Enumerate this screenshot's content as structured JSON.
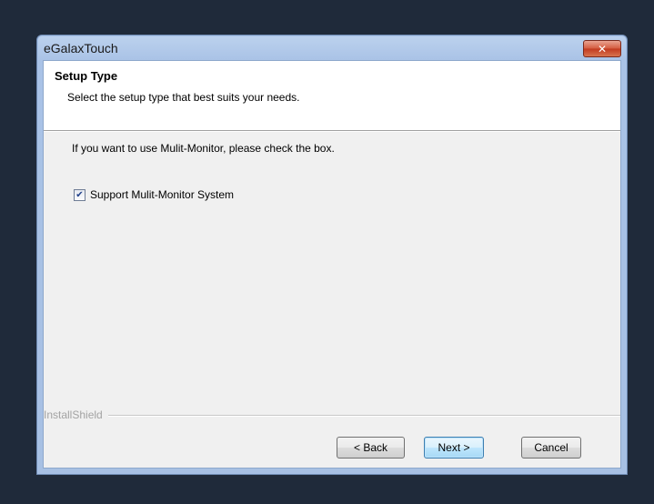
{
  "window": {
    "title": "eGalaxTouch",
    "close_label": "✕"
  },
  "header": {
    "title": "Setup Type",
    "subtitle": "Select the setup type that best suits your needs."
  },
  "content": {
    "instruction": "If you want to use Mulit-Monitor, please check the box.",
    "checkbox": {
      "label": "Support Mulit-Monitor System",
      "checked": true,
      "check_glyph": "✔"
    }
  },
  "footer": {
    "brand": "InstallShield",
    "back_label": "< Back",
    "next_label": "Next >",
    "cancel_label": "Cancel"
  },
  "colors": {
    "desktop": "#1f2a3a",
    "close": "#d45b3e",
    "default_button_border": "#3c7fb1"
  }
}
